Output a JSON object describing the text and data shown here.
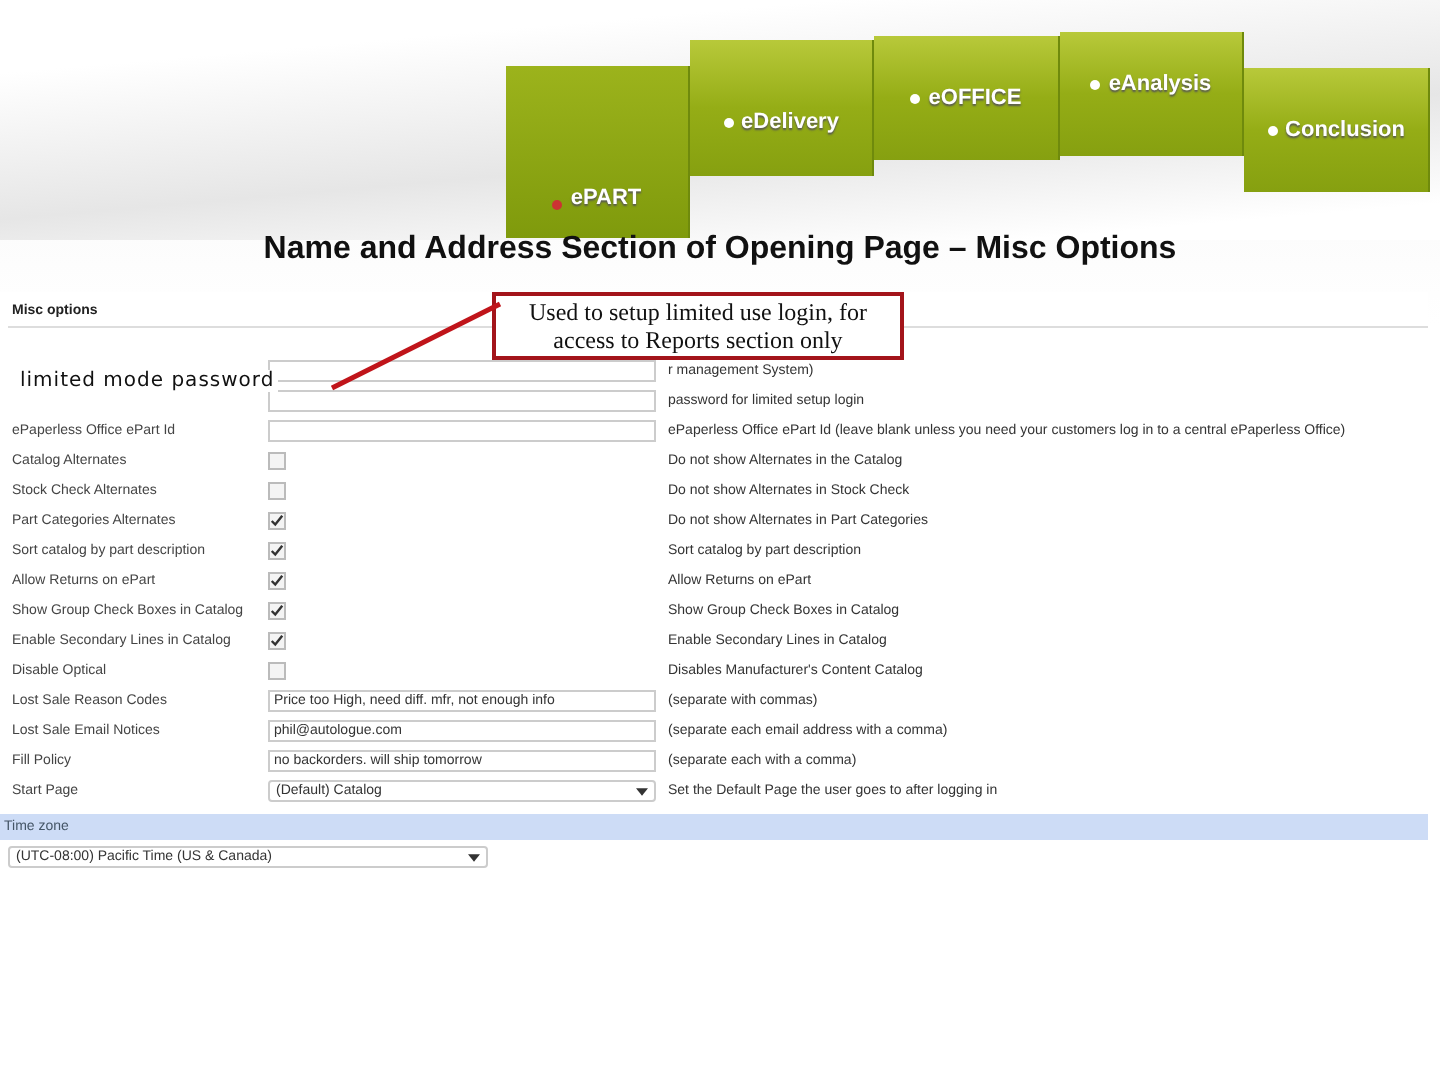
{
  "tabs": [
    {
      "label": "ePART",
      "selected": true
    },
    {
      "label": "eDelivery",
      "selected": false
    },
    {
      "label": "eOFFICE",
      "selected": false
    },
    {
      "label": "eAnalysis",
      "selected": false
    },
    {
      "label": "Conclusion",
      "selected": false
    }
  ],
  "title": "Name and Address Section of Opening Page – Misc Options",
  "callout": "Used to setup limited use login, for access to Reports section only",
  "annotation": "limited mode password",
  "panel": {
    "heading": "Misc options",
    "rows": [
      {
        "kind": "text",
        "value": "",
        "description": "r management System)"
      },
      {
        "kind": "text",
        "value": "",
        "description": "password for limited setup login"
      },
      {
        "kind": "text",
        "label": "ePaperless Office ePart Id",
        "value": "",
        "description": "ePaperless Office ePart Id (leave blank unless you need your customers log in to a central ePaperless Office)"
      },
      {
        "kind": "checkbox",
        "label": "Catalog Alternates",
        "checked": false,
        "description": "Do not show Alternates in the Catalog"
      },
      {
        "kind": "checkbox",
        "label": "Stock Check Alternates",
        "checked": false,
        "description": "Do not show Alternates in Stock Check"
      },
      {
        "kind": "checkbox",
        "label": "Part Categories Alternates",
        "checked": true,
        "description": "Do not show Alternates in Part Categories"
      },
      {
        "kind": "checkbox",
        "label": "Sort catalog by part description",
        "checked": true,
        "description": "Sort catalog by part description"
      },
      {
        "kind": "checkbox",
        "label": "Allow Returns on ePart",
        "checked": true,
        "description": "Allow Returns on ePart"
      },
      {
        "kind": "checkbox",
        "label": "Show Group Check Boxes in Catalog",
        "checked": true,
        "description": "Show Group Check Boxes in Catalog"
      },
      {
        "kind": "checkbox",
        "label": "Enable Secondary Lines in Catalog",
        "checked": true,
        "description": "Enable Secondary Lines in Catalog"
      },
      {
        "kind": "checkbox",
        "label": "Disable Optical",
        "checked": false,
        "description": "Disables Manufacturer's Content Catalog"
      },
      {
        "kind": "text",
        "label": "Lost Sale Reason Codes",
        "value": "Price too High, need diff. mfr, not enough info",
        "description": "(separate with commas)"
      },
      {
        "kind": "text",
        "label": "Lost Sale Email Notices",
        "value": "phil@autologue.com",
        "description": "(separate each email address with a comma)"
      },
      {
        "kind": "text",
        "label": "Fill Policy",
        "value": "no backorders. will ship tomorrow",
        "description": "(separate each with a comma)"
      },
      {
        "kind": "select",
        "label": "Start Page",
        "value": "(Default) Catalog",
        "description": "Set the Default Page the user goes to after logging in"
      }
    ],
    "section": "Time zone",
    "timezone": "(UTC-08:00) Pacific Time (US & Canada)"
  }
}
